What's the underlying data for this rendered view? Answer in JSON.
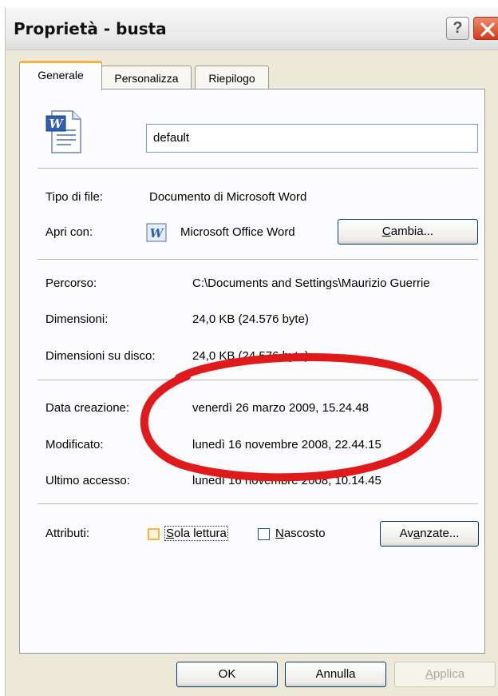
{
  "window": {
    "title": "Proprietà - busta",
    "help_label": "?",
    "icons": {
      "help": "help-icon",
      "close": "close-icon",
      "doc": "word-document-icon",
      "app": "word-app-icon"
    }
  },
  "tabs": [
    {
      "label": "Generale",
      "active": true
    },
    {
      "label": "Personalizza",
      "active": false
    },
    {
      "label": "Riepilogo",
      "active": false
    }
  ],
  "general": {
    "name_value": "default",
    "file_type_label": "Tipo di file:",
    "file_type_value": "Documento di Microsoft Word",
    "open_with_label": "Apri con:",
    "open_with_value": "Microsoft Office Word",
    "change_button": {
      "accel": "C",
      "rest": "ambia..."
    },
    "path_label": "Percorso:",
    "path_value": "C:\\Documents and Settings\\Maurizio Guerrie",
    "size_label": "Dimensioni:",
    "size_value": "24,0 KB (24.576 byte)",
    "disk_size_label": "Dimensioni su disco:",
    "disk_size_value": "24,0 KB (24.576 byte)",
    "created_label": "Data creazione:",
    "created_value": "venerdì 26 marzo 2009, 15.24.48",
    "modified_label": "Modificato:",
    "modified_value": "lunedì 16 novembre 2008, 22.44.15",
    "accessed_label": "Ultimo accesso:",
    "accessed_value": "lunedì 16 novembre 2008, 10.14.45",
    "attributes_label": "Attributi:",
    "readonly": {
      "accel": "S",
      "rest": "ola lettura",
      "checked": false
    },
    "hidden": {
      "accel": "N",
      "rest": "ascosto",
      "checked": false
    },
    "advanced_button": {
      "pre": "Av",
      "accel": "a",
      "post": "nzate..."
    }
  },
  "footer": {
    "ok_label": "OK",
    "cancel_label": "Annulla",
    "apply_button": {
      "accel": "A",
      "rest": "pplica",
      "enabled": false
    }
  },
  "annotation": {
    "color": "#e0191b",
    "shape": "hand-drawn ellipse around dates"
  }
}
